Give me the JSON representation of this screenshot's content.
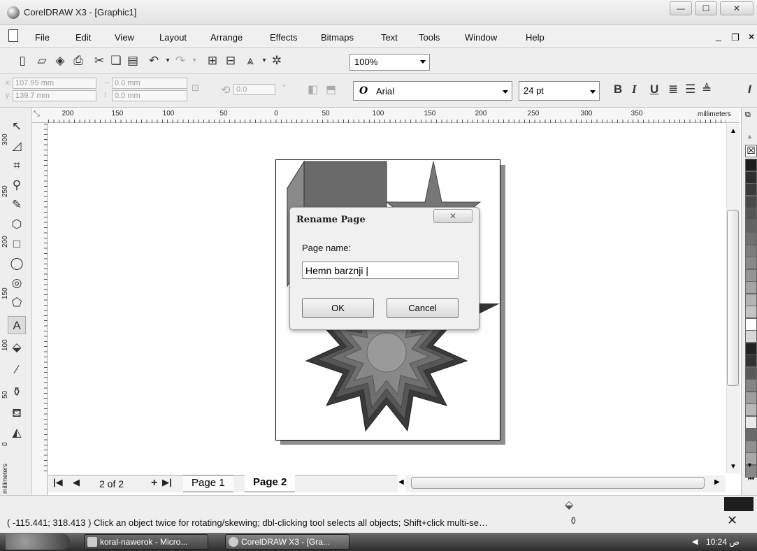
{
  "window": {
    "title": "CorelDRAW X3 - [Graphic1]",
    "minimize": "—",
    "maximize": "☐",
    "close": "✕"
  },
  "menu": {
    "items": [
      {
        "label": "File"
      },
      {
        "label": "Edit"
      },
      {
        "label": "View"
      },
      {
        "label": "Layout"
      },
      {
        "label": "Arrange"
      },
      {
        "label": "Effects"
      },
      {
        "label": "Bitmaps"
      },
      {
        "label": "Text"
      },
      {
        "label": "Tools"
      },
      {
        "label": "Window"
      },
      {
        "label": "Help"
      }
    ],
    "doc_min": "_",
    "doc_restore": "❐",
    "doc_close": "×"
  },
  "toolbar": {
    "zoom": "100%"
  },
  "propbar": {
    "x_label": "x:",
    "y_label": "y:",
    "x_value": "107.95 mm",
    "y_value": "139.7 mm",
    "w_value": "0.0 mm",
    "h_value": "0.0 mm",
    "angle_value": "0.0",
    "degree_symbol": "°",
    "font_icon": "O",
    "font_name": "Arial",
    "font_size": "24 pt",
    "bold": "B",
    "italic": "I",
    "underline": "U"
  },
  "ruler": {
    "unit": "millimeters",
    "htick_labels": [
      "200",
      "150",
      "100",
      "50",
      "0",
      "50",
      "100",
      "150",
      "200",
      "250",
      "300",
      "350"
    ],
    "vtick_labels": [
      "300",
      "250",
      "200",
      "150",
      "100",
      "50",
      "0"
    ],
    "vunit": "millimeters"
  },
  "palette": {
    "colors": [
      "#1c1c1c",
      "#2e2e2e",
      "#3b3b3b",
      "#4a4a4a",
      "#555555",
      "#636363",
      "#717171",
      "#7d7d7d",
      "#898989",
      "#959595",
      "#a4a4a4",
      "#b3b3b3",
      "#c4c4c4",
      "#ffffff",
      "#d7d7d7",
      "#222222",
      "#333333",
      "#5a5a5a",
      "#848484",
      "#9e9e9e",
      "#b8b8b8",
      "#e9e9e9",
      "#6a6a6a",
      "#909090",
      "#a8a8a8",
      "#888888"
    ]
  },
  "pages": {
    "first": "|◀",
    "prev": "◀",
    "count": "2 of 2",
    "add": "+",
    "last": "▶|",
    "tabs": [
      {
        "label": "Page 1"
      },
      {
        "label": "Page 2"
      }
    ]
  },
  "status": {
    "text": "( -115.441; 318.413 )  Click an object twice for rotating/skewing; dbl-clicking tool selects all objects; Shift+click multi-se…"
  },
  "taskbar": {
    "tasks": [
      {
        "label": "koral-nawerok - Micro..."
      },
      {
        "label": "CorelDRAW X3 - [Gra..."
      }
    ],
    "clock": "10:24 ص",
    "tray_arrow": "◀"
  },
  "dialog": {
    "title": "Rename Page",
    "close": "✕",
    "label": "Page name:",
    "input_value": "Hemn barznji |",
    "ok": "OK",
    "cancel": "Cancel"
  }
}
